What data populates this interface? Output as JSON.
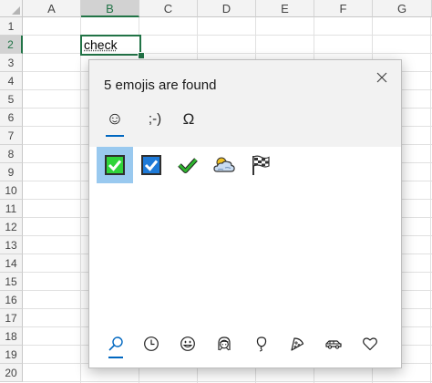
{
  "spreadsheet": {
    "columns": [
      "A",
      "B",
      "C",
      "D",
      "E",
      "F",
      "G"
    ],
    "rows": [
      "1",
      "2",
      "3",
      "4",
      "5",
      "6",
      "7",
      "8",
      "9",
      "10",
      "11",
      "12",
      "13",
      "14",
      "15",
      "16",
      "17",
      "18",
      "19",
      "20"
    ],
    "active_column": "B",
    "active_row": "2",
    "editing_cell_text": "check"
  },
  "emoji_panel": {
    "title": "5 emojis are found",
    "close_icon": "close-icon",
    "category_tabs": [
      {
        "label": "☺",
        "name": "tab-emoji",
        "active": true
      },
      {
        "label": ";-)",
        "name": "tab-kaomoji",
        "active": false
      },
      {
        "label": "Ω",
        "name": "tab-symbols",
        "active": false
      }
    ],
    "results": [
      {
        "name": "check-box-green-emoji",
        "selected": true
      },
      {
        "name": "check-box-blue-emoji",
        "selected": false
      },
      {
        "name": "check-mark-emoji",
        "selected": false
      },
      {
        "name": "cloud-sun-emoji",
        "selected": false
      },
      {
        "name": "checkered-flag-emoji",
        "selected": false
      }
    ],
    "bottom_nav": [
      {
        "name": "search-icon",
        "active": true
      },
      {
        "name": "recent-clock-icon",
        "active": false
      },
      {
        "name": "smiley-icon",
        "active": false
      },
      {
        "name": "person-icon",
        "active": false
      },
      {
        "name": "balloon-icon",
        "active": false
      },
      {
        "name": "pizza-icon",
        "active": false
      },
      {
        "name": "car-icon",
        "active": false
      },
      {
        "name": "heart-icon",
        "active": false
      }
    ],
    "colors": {
      "accent": "#0067c0",
      "selected_bg": "#99c9ef",
      "excel_green": "#217346"
    }
  }
}
